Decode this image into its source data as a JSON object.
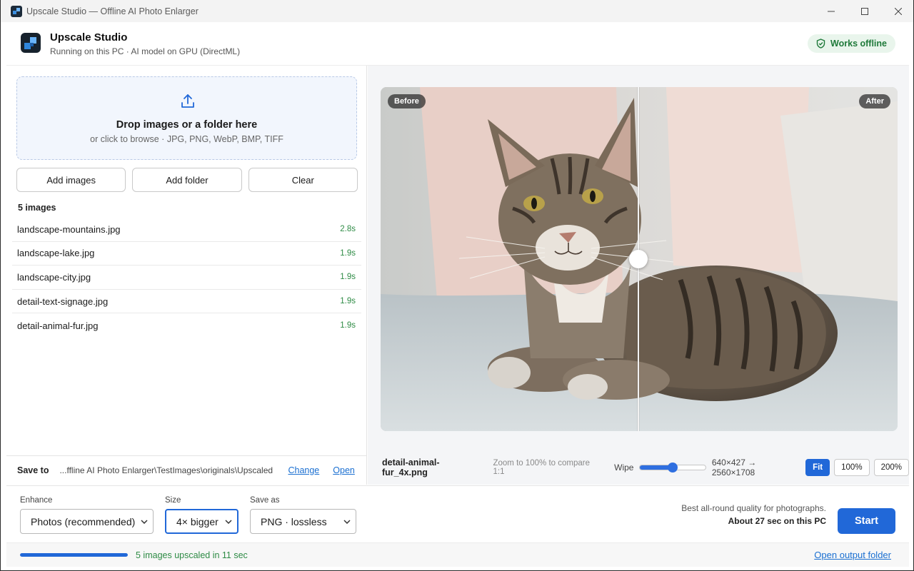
{
  "window": {
    "title": "Upscale Studio — Offline AI Photo Enlarger",
    "controls": {
      "minimize": "—",
      "maximize": "☐",
      "close": "✕"
    }
  },
  "header": {
    "app_name": "Upscale Studio",
    "subtitle": "Running on this PC · AI model on GPU (DirectML)",
    "badge": "Works offline"
  },
  "dropzone": {
    "title": "Drop images or a folder here",
    "subtitle": "or click to browse · JPG, PNG, WebP, BMP, TIFF"
  },
  "actions": {
    "add_images": "Add images",
    "add_folder": "Add folder",
    "clear": "Clear"
  },
  "file_list": {
    "count": "5 images",
    "items": [
      {
        "name": "landscape-mountains.jpg",
        "time": "2.8s"
      },
      {
        "name": "landscape-lake.jpg",
        "time": "1.9s"
      },
      {
        "name": "landscape-city.jpg",
        "time": "1.9s"
      },
      {
        "name": "detail-text-signage.jpg",
        "time": "1.9s"
      },
      {
        "name": "detail-animal-fur.jpg",
        "time": "1.9s"
      }
    ]
  },
  "save_to": {
    "label": "Save to",
    "path": "...ffline AI Photo Enlarger\\TestImages\\originals\\Upscaled",
    "change": "Change",
    "open": "Open"
  },
  "preview": {
    "before_tag": "Before",
    "after_tag": "After",
    "filename": "detail-animal-fur_4x.png",
    "hint": "Zoom to 100% to compare 1:1",
    "wipe_label": "Wipe",
    "wipe_value": 0.5,
    "dimensions": "640×427 → 2560×1708",
    "zoom": [
      "Fit",
      "100%",
      "200%"
    ],
    "zoom_active": "Fit"
  },
  "controls": {
    "enhance": {
      "label": "Enhance",
      "value": "Photos (recommended)"
    },
    "size": {
      "label": "Size",
      "value": "4× bigger"
    },
    "save_as": {
      "label": "Save as",
      "value": "PNG · lossless"
    },
    "estimate_line1": "Best all-round quality for photographs.",
    "estimate_line2": "About 27 sec on this PC",
    "start": "Start"
  },
  "status": {
    "progress": 1.0,
    "text": "5 images upscaled in 11 sec",
    "open_output": "Open output folder"
  },
  "colors": {
    "accent": "#2168d8",
    "success": "#2e8b45",
    "link": "#1a6fd1",
    "badge_bg": "#e9f5ec"
  },
  "icons": {
    "app": "upscale-studio-logo",
    "badge": "shield-check-icon",
    "drop": "upload-icon",
    "select": "chevron-down-icon"
  }
}
